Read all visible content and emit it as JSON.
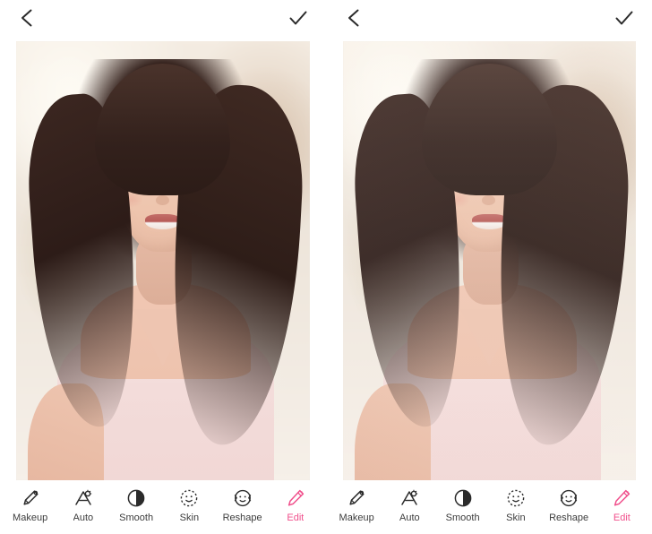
{
  "app": {
    "screens": [
      {
        "id": "before",
        "topbar": {
          "back_icon": "back-arrow-icon",
          "confirm_icon": "checkmark-icon"
        },
        "photo": {
          "alt": "portrait-photo-original"
        },
        "toolbar": {
          "items": [
            {
              "label": "Makeup",
              "icon": "lipstick-icon",
              "active": false
            },
            {
              "label": "Auto",
              "icon": "auto-magic-icon",
              "active": false
            },
            {
              "label": "Smooth",
              "icon": "contrast-circle-icon",
              "active": false
            },
            {
              "label": "Skin",
              "icon": "face-dotted-icon",
              "active": false
            },
            {
              "label": "Reshape",
              "icon": "face-reshape-icon",
              "active": false
            },
            {
              "label": "Edit",
              "icon": "edit-pen-icon",
              "active": true
            }
          ]
        }
      },
      {
        "id": "after",
        "topbar": {
          "back_icon": "back-arrow-icon",
          "confirm_icon": "checkmark-icon"
        },
        "photo": {
          "alt": "portrait-photo-retouched"
        },
        "toolbar": {
          "items": [
            {
              "label": "Makeup",
              "icon": "lipstick-icon",
              "active": false
            },
            {
              "label": "Auto",
              "icon": "auto-magic-icon",
              "active": false
            },
            {
              "label": "Smooth",
              "icon": "contrast-circle-icon",
              "active": false
            },
            {
              "label": "Skin",
              "icon": "face-dotted-icon",
              "active": false
            },
            {
              "label": "Reshape",
              "icon": "face-reshape-icon",
              "active": false
            },
            {
              "label": "Edit",
              "icon": "edit-pen-icon",
              "active": true
            }
          ]
        }
      }
    ]
  },
  "colors": {
    "accent": "#f0508c",
    "icon": "#2b2b2b",
    "label": "#3c3c3c",
    "background": "#ffffff"
  }
}
